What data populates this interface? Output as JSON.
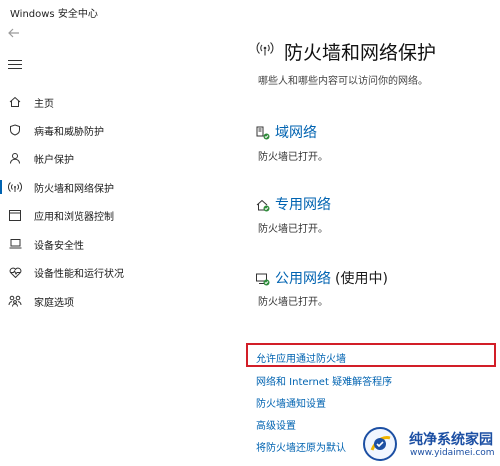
{
  "window": {
    "title": "Windows 安全中心"
  },
  "sidebar": {
    "back_icon": "back-arrow-icon",
    "menu_icon": "hamburger-menu-icon",
    "items": [
      {
        "label": "主页",
        "icon": "home-icon",
        "selected": false
      },
      {
        "label": "病毒和威胁防护",
        "icon": "shield-icon",
        "selected": false
      },
      {
        "label": "帐户保护",
        "icon": "person-icon",
        "selected": false
      },
      {
        "label": "防火墙和网络保护",
        "icon": "wireless-icon",
        "selected": true
      },
      {
        "label": "应用和浏览器控制",
        "icon": "app-window-icon",
        "selected": false
      },
      {
        "label": "设备安全性",
        "icon": "laptop-icon",
        "selected": false
      },
      {
        "label": "设备性能和运行状况",
        "icon": "heart-icon",
        "selected": false
      },
      {
        "label": "家庭选项",
        "icon": "family-icon",
        "selected": false
      }
    ]
  },
  "main": {
    "title": "防火墙和网络保护",
    "subtitle": "哪些人和哪些内容可以访问你的网络。",
    "networks": [
      {
        "name": "域网络",
        "suffix": "",
        "status": "防火墙已打开。",
        "icon": "domain-network-icon"
      },
      {
        "name": "专用网络",
        "suffix": "",
        "status": "防火墙已打开。",
        "icon": "private-network-icon"
      },
      {
        "name": "公用网络",
        "suffix": "(使用中)",
        "status": "防火墙已打开。",
        "icon": "public-network-icon"
      }
    ],
    "links": [
      "允许应用通过防火墙",
      "网络和 Internet 疑难解答程序",
      "防火墙通知设置",
      "高级设置",
      "将防火墙还原为默认"
    ]
  },
  "watermark": {
    "name": "纯净系统家园",
    "url": "www.yidaimei.com"
  },
  "colors": {
    "accent": "#0063b1",
    "highlight": "#d21e28"
  }
}
